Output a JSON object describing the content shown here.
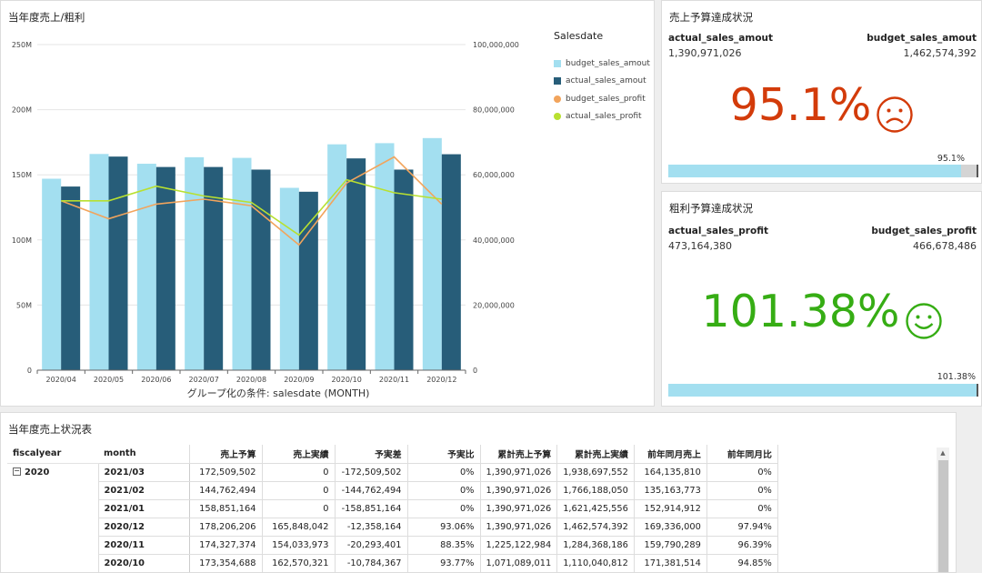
{
  "chart_panel": {
    "title": "当年度売上/粗利",
    "legend_title": "Salesdate",
    "xlabel": "グループ化の条件: salesdate (MONTH)"
  },
  "chart_data": {
    "type": "bar",
    "categories": [
      "2020/04",
      "2020/05",
      "2020/06",
      "2020/07",
      "2020/08",
      "2020/09",
      "2020/10",
      "2020/11",
      "2020/12"
    ],
    "y_left": {
      "ticks": [
        "0",
        "50M",
        "100M",
        "150M",
        "200M",
        "250M"
      ],
      "range": [
        0,
        250000000
      ]
    },
    "y_right": {
      "ticks": [
        "0",
        "20,000,000",
        "40,000,000",
        "60,000,000",
        "80,000,000",
        "100,000,000"
      ],
      "range": [
        0,
        100000000
      ]
    },
    "series": [
      {
        "name": "budget_sales_amout",
        "kind": "bar",
        "axis": "left",
        "color": "#a3dff0",
        "values": [
          147000000,
          166000000,
          158500000,
          163500000,
          163000000,
          140000000,
          173400000,
          174300000,
          178200000
        ]
      },
      {
        "name": "actual_sales_amout",
        "kind": "bar",
        "axis": "left",
        "color": "#275d79",
        "values": [
          141000000,
          164000000,
          156000000,
          156000000,
          154000000,
          137000000,
          162600000,
          154000000,
          165800000
        ]
      },
      {
        "name": "budget_sales_profit",
        "kind": "line",
        "axis": "right",
        "color": "#f2a45c",
        "values": [
          52000000,
          46500000,
          51000000,
          52500000,
          50500000,
          38500000,
          57500000,
          65500000,
          51000000
        ]
      },
      {
        "name": "actual_sales_profit",
        "kind": "line",
        "axis": "right",
        "color": "#b8e030",
        "values": [
          52000000,
          52000000,
          56500000,
          53500000,
          51500000,
          41500000,
          58500000,
          54500000,
          52500000
        ]
      }
    ],
    "grid": true,
    "legend": "right"
  },
  "kpi_sales": {
    "title": "売上予算達成状況",
    "actual_label": "actual_sales_amout",
    "actual_value": "1,390,971,026",
    "budget_label": "budget_sales_amout",
    "budget_value": "1,462,574,392",
    "percent": "95.1%",
    "face": "sad-face-icon",
    "bar_label": "95.1%",
    "bar_fraction": 0.951,
    "color": "#d33b0a"
  },
  "kpi_profit": {
    "title": "粗利予算達成状況",
    "actual_label": "actual_sales_profit",
    "actual_value": "473,164,380",
    "budget_label": "budget_sales_profit",
    "budget_value": "466,678,486",
    "percent": "101.38%",
    "face": "smile-face-icon",
    "bar_label": "101.38%",
    "bar_fraction": 1.0138,
    "color": "#36ad14"
  },
  "table": {
    "title": "当年度売上状況表",
    "headers": [
      "fiscalyear",
      "month",
      "売上予算",
      "売上実績",
      "予実差",
      "予実比",
      "累計売上予算",
      "累計売上実績",
      "前年同月売上",
      "前年同月比"
    ],
    "fiscalyear": "2020",
    "collapse_glyph": "−",
    "rows": [
      [
        "2021/03",
        "172,509,502",
        "0",
        "-172,509,502",
        "0%",
        "1,390,971,026",
        "1,938,697,552",
        "164,135,810",
        "0%"
      ],
      [
        "2021/02",
        "144,762,494",
        "0",
        "-144,762,494",
        "0%",
        "1,390,971,026",
        "1,766,188,050",
        "135,163,773",
        "0%"
      ],
      [
        "2021/01",
        "158,851,164",
        "0",
        "-158,851,164",
        "0%",
        "1,390,971,026",
        "1,621,425,556",
        "152,914,912",
        "0%"
      ],
      [
        "2020/12",
        "178,206,206",
        "165,848,042",
        "-12,358,164",
        "93.06%",
        "1,390,971,026",
        "1,462,574,392",
        "169,336,000",
        "97.94%"
      ],
      [
        "2020/11",
        "174,327,374",
        "154,033,973",
        "-20,293,401",
        "88.35%",
        "1,225,122,984",
        "1,284,368,186",
        "159,790,289",
        "96.39%"
      ],
      [
        "2020/10",
        "173,354,688",
        "162,570,321",
        "-10,784,367",
        "93.77%",
        "1,071,089,011",
        "1,110,040,812",
        "171,381,514",
        "94.85%"
      ]
    ]
  }
}
